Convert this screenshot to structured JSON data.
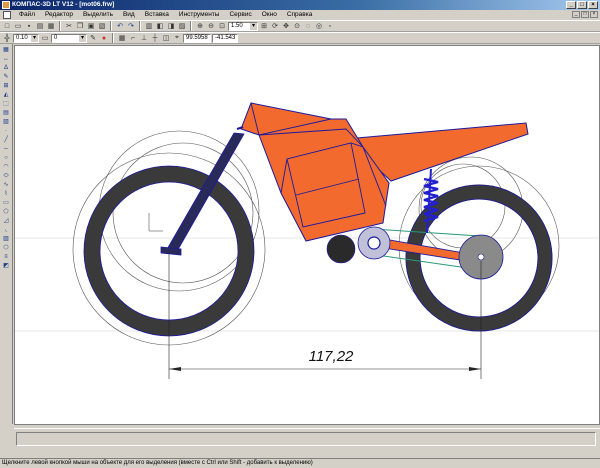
{
  "window": {
    "title": "КОМПАС-3D LT V12 - [mot06.frw]"
  },
  "menu": [
    "Файл",
    "Редактор",
    "Выделить",
    "Вид",
    "Вставка",
    "Инструменты",
    "Сервис",
    "Окно",
    "Справка"
  ],
  "toolbar": {
    "zoom_value": "1.50"
  },
  "toolbar2": {
    "step_value": "0.10",
    "layer_value": "0",
    "coord_x": "99.5958",
    "coord_y": "-41.543"
  },
  "drawing": {
    "dimension_value": "117,22",
    "colors": {
      "frame_fill": "#f26a2e",
      "outline": "#1a1aa0",
      "tire": "#3a3a3a",
      "spring": "#2020d0",
      "chain": "#2a9a7a"
    }
  },
  "status": {
    "text": "Щелкните левой кнопкой мыши на объекте для его выделения (вместе с Ctrl или Shift - добавить к выделению)"
  }
}
